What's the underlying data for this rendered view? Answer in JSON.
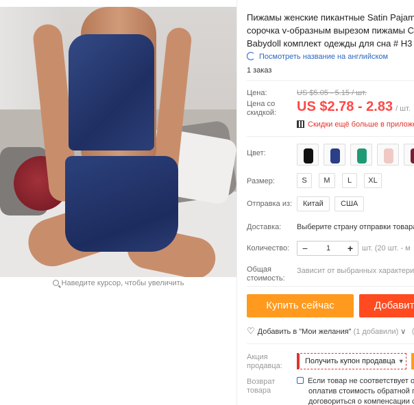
{
  "gallery": {
    "zoom_hint": "Наведите курсор, чтобы увеличить"
  },
  "product": {
    "title_lines": [
      "Пижамы женские пикантные Satin Pajam",
      "сорочка v-образным вырезом пижамы С",
      "Babydoll комплект одежды для сна # H3"
    ],
    "translate_link": "Посмотреть название на английском",
    "orders": "1 заказ"
  },
  "pricing": {
    "price_label": "Цена:",
    "old_price": "US $5.05 - 5.15 / шт.",
    "discount_label_1": "Цена со",
    "discount_label_2": "скидкой:",
    "price": "US $2.78 - 2.83",
    "unit": "/ шт.",
    "app_discount": "Скидки ещё больше в приложе"
  },
  "options": {
    "color_label": "Цвет:",
    "colors": [
      "#111111",
      "#2b3f86",
      "#1f9a74",
      "#f0c9c4",
      "#7a1f35"
    ],
    "size_label": "Размер:",
    "sizes": [
      "S",
      "M",
      "L",
      "XL"
    ],
    "ship_from_label": "Отправка из:",
    "ship_from": [
      "Китай",
      "США"
    ],
    "delivery_label": "Доставка:",
    "delivery_note": "Выберите страну отправки товара",
    "qty_label": "Количество:",
    "qty_minus": "−",
    "qty_value": "1",
    "qty_plus": "+",
    "stock": "шт. (20 шт. - м",
    "total_label_1": "Общая",
    "total_label_2": "стоимость:",
    "total_note": "Зависит от выбранных характери"
  },
  "actions": {
    "buy_now": "Купить сейчас",
    "add_to_cart": "Добавит",
    "wishlist": "Добавить в \"Мои желания\"",
    "wishlist_count": "(1 добавили)",
    "chevron": "∨"
  },
  "seller": {
    "promo_label_1": "Акция",
    "promo_label_2": "продавца:",
    "coupon": "Получить купон продавца",
    "return_label_1": "Возврат",
    "return_label_2": "товара",
    "return_lines": [
      "Если товар не соответствует оп",
      "оплатив стоимость обратной п",
      "договориться о компенсации с"
    ]
  }
}
